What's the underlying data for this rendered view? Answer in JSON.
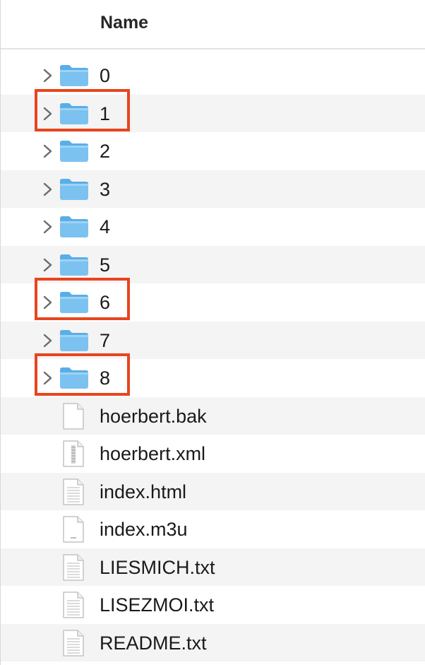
{
  "header": {
    "name_column": "Name"
  },
  "items": [
    {
      "label": "0",
      "kind": "folder",
      "icon": "folder-icon",
      "highlighted": false
    },
    {
      "label": "1",
      "kind": "folder",
      "icon": "folder-icon",
      "highlighted": true
    },
    {
      "label": "2",
      "kind": "folder",
      "icon": "folder-icon",
      "highlighted": false
    },
    {
      "label": "3",
      "kind": "folder",
      "icon": "folder-icon",
      "highlighted": false
    },
    {
      "label": "4",
      "kind": "folder",
      "icon": "folder-icon",
      "highlighted": false
    },
    {
      "label": "5",
      "kind": "folder",
      "icon": "folder-icon",
      "highlighted": false
    },
    {
      "label": "6",
      "kind": "folder",
      "icon": "folder-icon",
      "highlighted": true
    },
    {
      "label": "7",
      "kind": "folder",
      "icon": "folder-icon",
      "highlighted": false
    },
    {
      "label": "8",
      "kind": "folder",
      "icon": "folder-icon",
      "highlighted": true
    },
    {
      "label": "hoerbert.bak",
      "kind": "file",
      "icon": "blank-document-icon",
      "highlighted": false
    },
    {
      "label": "hoerbert.xml",
      "kind": "file",
      "icon": "xml-document-icon",
      "highlighted": false
    },
    {
      "label": "index.html",
      "kind": "file",
      "icon": "html-document-icon",
      "highlighted": false
    },
    {
      "label": "index.m3u",
      "kind": "file",
      "icon": "playlist-document-icon",
      "highlighted": false
    },
    {
      "label": "LIESMICH.txt",
      "kind": "file",
      "icon": "text-document-icon",
      "highlighted": false
    },
    {
      "label": "LISEZMOI.txt",
      "kind": "file",
      "icon": "text-document-icon",
      "highlighted": false
    },
    {
      "label": "README.txt",
      "kind": "file",
      "icon": "text-document-icon",
      "highlighted": false
    }
  ],
  "colors": {
    "folder_body": "#7cc2f0",
    "folder_tab": "#5aaee8",
    "highlight": "#e8451e",
    "alt_row": "#f4f4f4"
  }
}
